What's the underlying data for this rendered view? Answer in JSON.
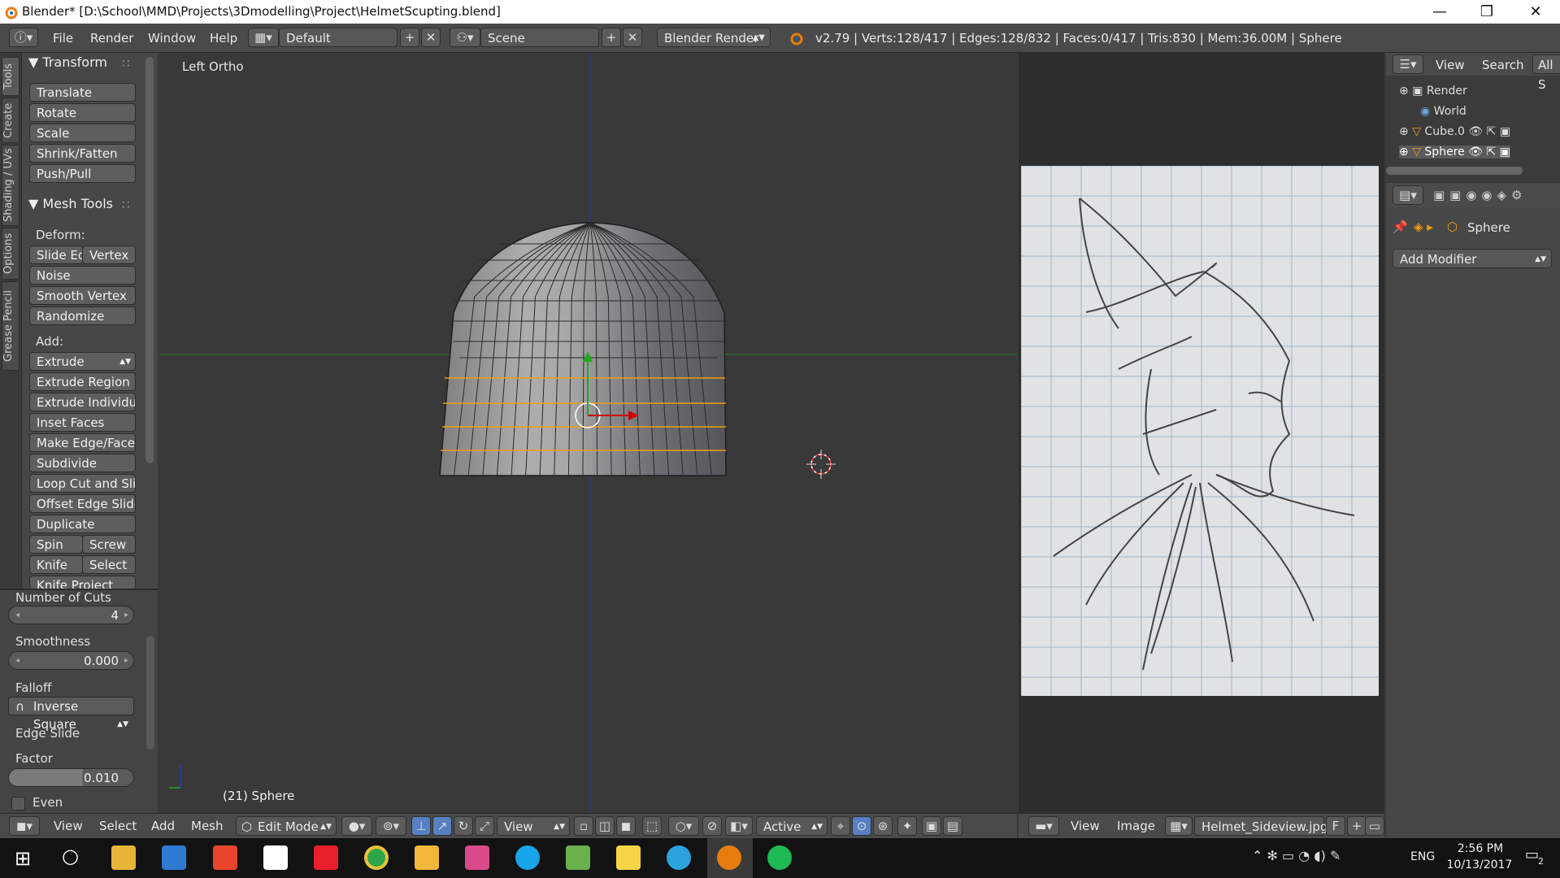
{
  "window": {
    "title": "Blender* [D:\\School\\MMD\\Projects\\3Dmodelling\\Project\\HelmetScupting.blend]",
    "minimize": "—",
    "maximize": "❐",
    "close": "✕"
  },
  "topbar": {
    "menus": [
      "File",
      "Render",
      "Window",
      "Help"
    ],
    "layout": "Default",
    "scene": "Scene",
    "engine": "Blender Render",
    "stats": "v2.79 | Verts:128/417 | Edges:128/832 | Faces:0/417 | Tris:830 | Mem:36.00M | Sphere"
  },
  "tabs": [
    "Tools",
    "Create",
    "Shading / UVs",
    "Options",
    "Grease Pencil"
  ],
  "toolshelf": {
    "transform_title": "Transform",
    "transform": [
      "Translate",
      "Rotate",
      "Scale",
      "Shrink/Fatten",
      "Push/Pull"
    ],
    "mesh_tools_title": "Mesh Tools",
    "deform_label": "Deform:",
    "slide_edge": "Slide Ed",
    "vertex": "Vertex",
    "noise": "Noise",
    "smooth_vertex": "Smooth Vertex",
    "randomize": "Randomize",
    "add_label": "Add:",
    "extrude": "Extrude",
    "extrude_region": "Extrude Region",
    "extrude_individual": "Extrude Individual",
    "inset_faces": "Inset Faces",
    "make_edge_face": "Make Edge/Face",
    "subdivide": "Subdivide",
    "loop_cut": "Loop Cut and Sli...",
    "offset_edge_slide": "Offset Edge Slide",
    "duplicate": "Duplicate",
    "spin": "Spin",
    "screw": "Screw",
    "knife": "Knife",
    "select": "Select",
    "knife_project": "Knife Project"
  },
  "operator": {
    "cuts_label": "Number of Cuts",
    "cuts_value": "4",
    "smoothness_label": "Smoothness",
    "smoothness_value": "0.000",
    "falloff_label": "Falloff",
    "falloff_value": "Inverse Square",
    "edge_slide_label": "Edge Slide",
    "factor_label": "Factor",
    "factor_value": "0.010",
    "even_label": "Even"
  },
  "viewport": {
    "view_name": "Left Ortho",
    "object_info": "(21) Sphere"
  },
  "outliner": {
    "view": "View",
    "search": "Search",
    "all": "All S",
    "items": [
      "Render",
      "World",
      "Cube.0",
      "Sphere"
    ]
  },
  "properties": {
    "object": "Sphere",
    "add_modifier": "Add Modifier"
  },
  "vp_footer": {
    "view": "View",
    "select": "Select",
    "add": "Add",
    "mesh": "Mesh",
    "mode": "Edit Mode",
    "orient": "View",
    "pivot": "Active"
  },
  "img_footer": {
    "view": "View",
    "image": "Image",
    "filename": "Helmet_Sideview.jpg",
    "f": "F"
  },
  "taskbar": {
    "lang": "ENG",
    "time": "2:56 PM",
    "date": "10/13/2017",
    "notifications": "2"
  },
  "colors": {
    "selection": "#f39c12",
    "x_axis": "#cc0000",
    "y_axis": "#22aa22",
    "z_axis": "#2233cc",
    "accent": "#5680c2"
  }
}
